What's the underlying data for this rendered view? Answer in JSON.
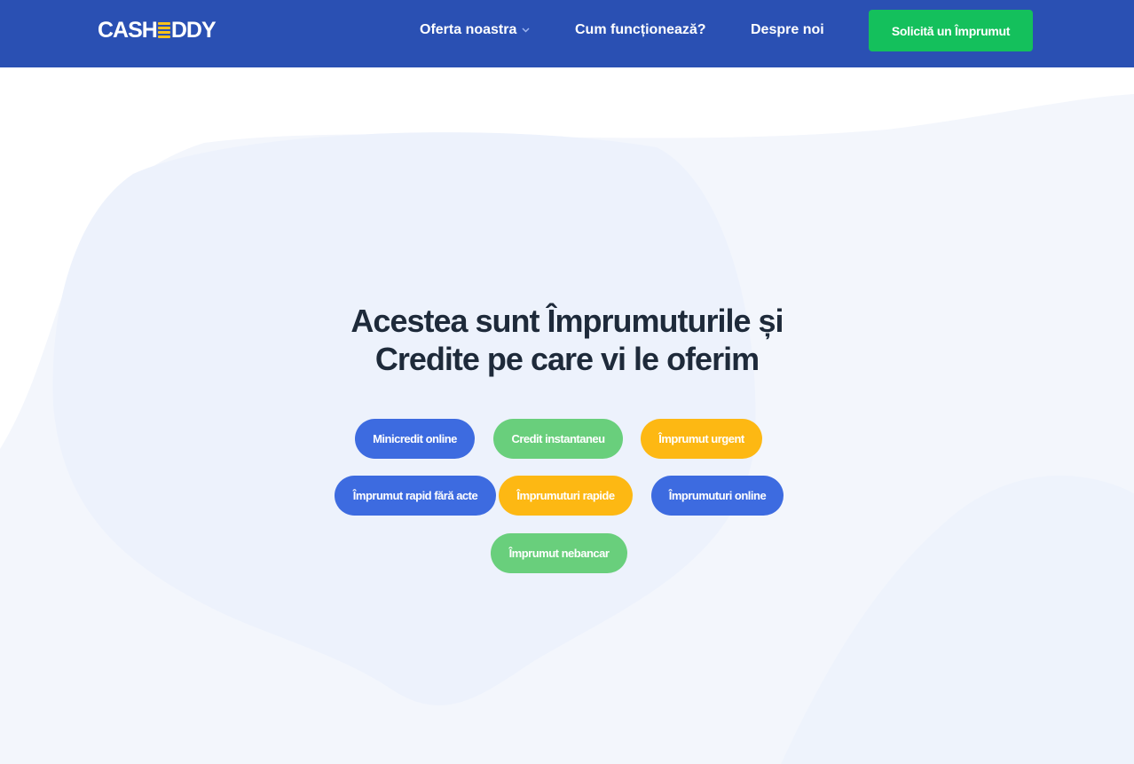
{
  "header": {
    "logo": {
      "left": "CASH",
      "right": "DDY"
    },
    "nav": {
      "offer": "Oferta noastra",
      "how": "Cum funcționează?",
      "about": "Despre noi"
    },
    "cta_label": "Solicită un Împrumut"
  },
  "main": {
    "headline_line1": "Acestea sunt Împrumuturile și",
    "headline_line2": "Credite pe care vi le oferim",
    "tags": [
      {
        "label": "Minicredit online",
        "color": "#3d6be0"
      },
      {
        "label": "Credit instantaneu",
        "color": "#69cf7c"
      },
      {
        "label": "Împrumut urgent",
        "color": "#fdb813"
      },
      {
        "label": "Împrumut rapid fără acte",
        "color": "#3d6be0"
      },
      {
        "label": "Împrumuturi rapide",
        "color": "#fdb813"
      },
      {
        "label": "Împrumuturi online",
        "color": "#3d6be0"
      },
      {
        "label": "Împrumut nebancar",
        "color": "#69cf7c"
      }
    ]
  },
  "colors": {
    "header_bg": "#2a50b3",
    "cta_bg": "#14c05c",
    "logo_accent": "#f7c21a",
    "headline_text": "#1e2a3a",
    "blob_bg": "#f2f6fd"
  }
}
